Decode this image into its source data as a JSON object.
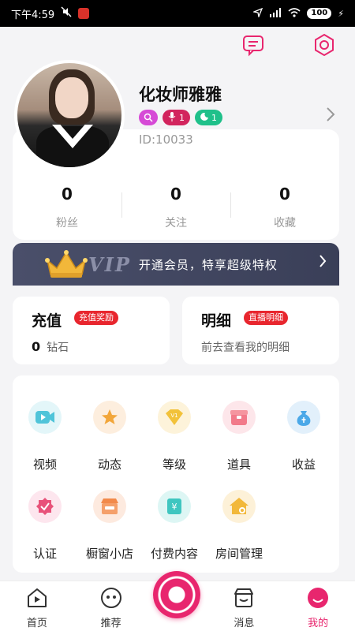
{
  "status_bar": {
    "time": "下午4:59",
    "battery": "100"
  },
  "profile": {
    "name": "化妆师雅雅",
    "badge_mic_level": "1",
    "badge_moon_level": "1",
    "id_text": "ID:10033"
  },
  "stats": [
    {
      "value": "0",
      "label": "粉丝"
    },
    {
      "value": "0",
      "label": "关注"
    },
    {
      "value": "0",
      "label": "收藏"
    }
  ],
  "vip": {
    "word": "VIP",
    "text": "开通会员，特享超级特权"
  },
  "recharge": {
    "title": "充值",
    "tag": "充值奖励",
    "amount": "0",
    "unit": "钻石"
  },
  "details": {
    "title": "明细",
    "tag": "直播明细",
    "subtitle": "前去查看我的明细"
  },
  "grid": [
    {
      "label": "视频",
      "icon": "video-icon",
      "color": "#4fc4d9"
    },
    {
      "label": "动态",
      "icon": "star-icon",
      "color": "#f2a63a"
    },
    {
      "label": "等级",
      "icon": "level-icon",
      "color": "#f2c23a"
    },
    {
      "label": "道具",
      "icon": "gift-box-icon",
      "color": "#f27a8a"
    },
    {
      "label": "收益",
      "icon": "money-bag-icon",
      "color": "#4aa8e8"
    },
    {
      "label": "认证",
      "icon": "verified-icon",
      "color": "#e8527a"
    },
    {
      "label": "橱窗小店",
      "icon": "shop-icon",
      "color": "#f28a4a"
    },
    {
      "label": "付费内容",
      "icon": "paid-content-icon",
      "color": "#3fc6c0"
    },
    {
      "label": "房间管理",
      "icon": "room-manage-icon",
      "color": "#f2b83a"
    }
  ],
  "bottom_nav": [
    {
      "label": "首页",
      "icon": "home-icon"
    },
    {
      "label": "推荐",
      "icon": "recommend-icon"
    },
    {
      "label": "消息",
      "icon": "message-icon"
    },
    {
      "label": "我的",
      "icon": "me-icon"
    }
  ],
  "colors": {
    "accent": "#e8266e",
    "tag_red": "#e8262e",
    "vip_bg": "#4a4f6a"
  }
}
